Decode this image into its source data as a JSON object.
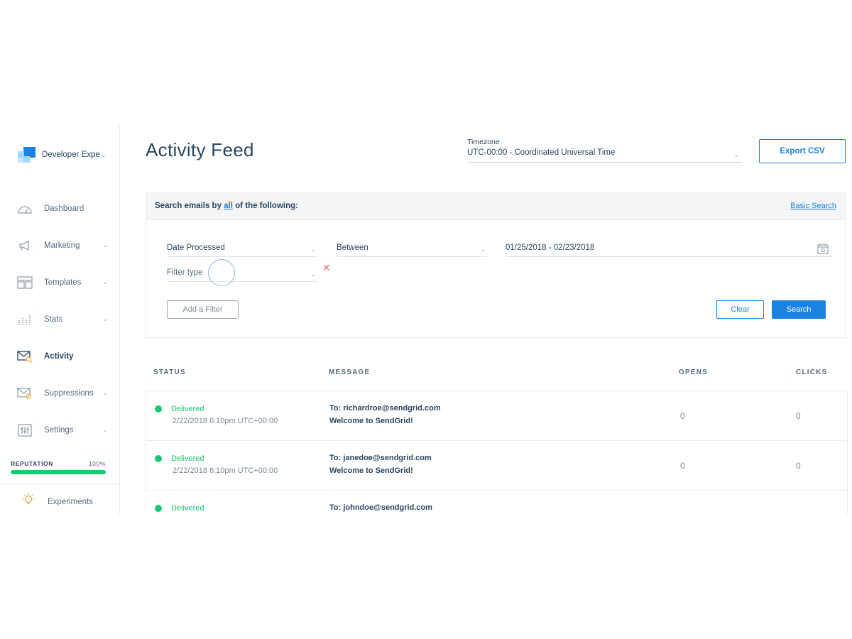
{
  "account": {
    "name": "Developer Expe",
    "caret": "⌄"
  },
  "sidebar": {
    "items": [
      {
        "label": "Dashboard",
        "has_chevron": false
      },
      {
        "label": "Marketing",
        "has_chevron": true
      },
      {
        "label": "Templates",
        "has_chevron": true
      },
      {
        "label": "Stats",
        "has_chevron": true
      },
      {
        "label": "Activity",
        "has_chevron": false,
        "active": true
      },
      {
        "label": "Suppressions",
        "has_chevron": true
      },
      {
        "label": "Settings",
        "has_chevron": true
      }
    ],
    "chevron": "⌄",
    "reputation": {
      "label": "REPUTATION",
      "value": "100%",
      "fraction": 1.0
    },
    "experiments": "Experiments"
  },
  "header": {
    "title": "Activity Feed",
    "timezone_label": "Timezone",
    "timezone_value": "UTC-00:00 - Coordinated Universal Time",
    "export_label": "Export CSV"
  },
  "search": {
    "prefix": "Search emails by",
    "all": "all",
    "suffix": "of the following:",
    "basic_search": "Basic Search",
    "filter1": {
      "field": "Date Processed",
      "operator": "Between",
      "value": "01/25/2018 - 02/23/2018"
    },
    "filter2": {
      "placeholder": "Filter type"
    },
    "remove": "✕",
    "add_filter": "Add a Filter",
    "clear": "Clear",
    "search": "Search"
  },
  "table": {
    "headers": {
      "status": "STATUS",
      "message": "MESSAGE",
      "opens": "OPENS",
      "clicks": "CLICKS"
    },
    "rows": [
      {
        "status": "Delivered",
        "time": "2/22/2018 6:10pm UTC+00:00",
        "to": "To: richardroe@sendgrid.com",
        "subject": "Welcome to SendGrid!",
        "opens": "0",
        "clicks": "0"
      },
      {
        "status": "Delivered",
        "time": "2/22/2018 6:10pm UTC+00:00",
        "to": "To: janedoe@sendgrid.com",
        "subject": "Welcome to SendGrid!",
        "opens": "0",
        "clicks": "0"
      },
      {
        "status": "Delivered",
        "time": "",
        "to": "To: johndoe@sendgrid.com",
        "subject": "",
        "opens": "",
        "clicks": ""
      }
    ]
  },
  "colors": {
    "brand_blue": "#1a82e2",
    "delivered_green": "#18c96e",
    "text_navy": "#294661",
    "remove_red": "#f26c5e"
  }
}
